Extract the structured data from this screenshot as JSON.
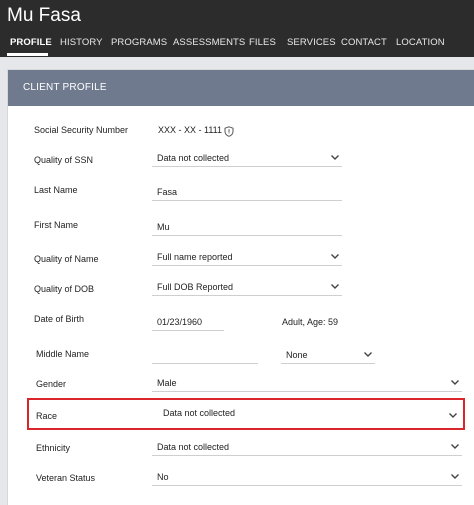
{
  "header": {
    "client_name": "Mu Fasa",
    "tabs": [
      "PROFILE",
      "HISTORY",
      "PROGRAMS",
      "ASSESSMENTS",
      "FILES",
      "SERVICES",
      "CONTACT",
      "LOCATION"
    ]
  },
  "panel": {
    "title": "CLIENT PROFILE"
  },
  "form": {
    "ssn_label": "Social Security Number",
    "ssn_value": "XXX - XX - 1111",
    "quality_ssn_label": "Quality of SSN",
    "quality_ssn_value": "Data not collected",
    "last_name_label": "Last Name",
    "last_name_value": "Fasa",
    "first_name_label": "First Name",
    "first_name_value": "Mu",
    "quality_name_label": "Quality of Name",
    "quality_name_value": "Full name reported",
    "quality_dob_label": "Quality of DOB",
    "quality_dob_value": "Full DOB Reported",
    "dob_label": "Date of Birth",
    "dob_value": "01/23/1960",
    "age_label": "Adult, Age:",
    "age_value": "59",
    "middle_name_label": "Middle Name",
    "middle_name_value": "",
    "suffix_value": "None",
    "gender_label": "Gender",
    "gender_value": "Male",
    "race_label": "Race",
    "race_value": "Data not collected",
    "ethnicity_label": "Ethnicity",
    "ethnicity_value": "Data not collected",
    "veteran_label": "Veteran Status",
    "veteran_value": "No"
  },
  "colors": {
    "header_bg": "#2c2c2c",
    "panel_header_bg": "#6f7a8f",
    "highlight_border": "#d9262b"
  },
  "icons": [
    "shield-icon",
    "chevron-down-icon"
  ]
}
